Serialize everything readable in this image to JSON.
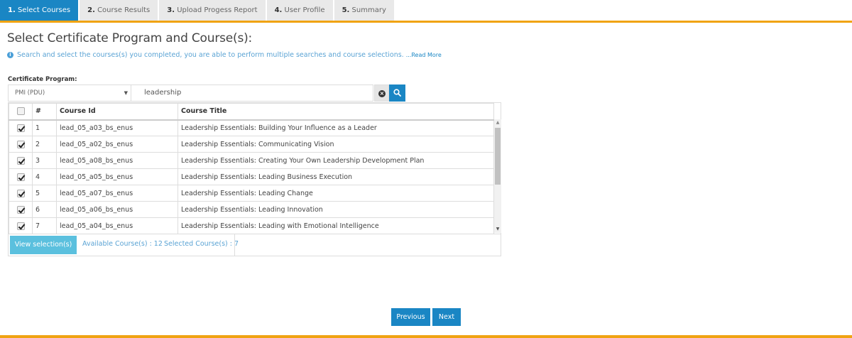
{
  "tabs": [
    {
      "num": "1.",
      "label": "Select Courses",
      "active": true
    },
    {
      "num": "2.",
      "label": "Course Results",
      "active": false
    },
    {
      "num": "3.",
      "label": "Upload Progess Report",
      "active": false
    },
    {
      "num": "4.",
      "label": "User Profile",
      "active": false
    },
    {
      "num": "5.",
      "label": "Summary",
      "active": false
    }
  ],
  "heading": "Select Certificate Program and Course(s):",
  "info": {
    "text": "Search and select the courses(s) you completed, you are able to perform multiple searches and course selections.",
    "read_more": "...Read More"
  },
  "program": {
    "label": "Certificate Program:",
    "selected": "PMI (PDU)"
  },
  "search": {
    "value": "leadership"
  },
  "table": {
    "headers": {
      "num": "#",
      "id": "Course Id",
      "title": "Course Title"
    },
    "rows": [
      {
        "num": "1",
        "id": "lead_05_a03_bs_enus",
        "title": "Leadership Essentials: Building Your Influence as a Leader",
        "checked": true
      },
      {
        "num": "2",
        "id": "lead_05_a02_bs_enus",
        "title": "Leadership Essentials: Communicating Vision",
        "checked": true
      },
      {
        "num": "3",
        "id": "lead_05_a08_bs_enus",
        "title": "Leadership Essentials: Creating Your Own Leadership Development Plan",
        "checked": true
      },
      {
        "num": "4",
        "id": "lead_05_a05_bs_enus",
        "title": "Leadership Essentials: Leading Business Execution",
        "checked": true
      },
      {
        "num": "5",
        "id": "lead_05_a07_bs_enus",
        "title": "Leadership Essentials: Leading Change",
        "checked": true
      },
      {
        "num": "6",
        "id": "lead_05_a06_bs_enus",
        "title": "Leadership Essentials: Leading Innovation",
        "checked": true
      },
      {
        "num": "7",
        "id": "lead_05_a04_bs_enus",
        "title": "Leadership Essentials: Leading with Emotional Intelligence",
        "checked": true
      }
    ]
  },
  "footer": {
    "view_button": "View selection(s)",
    "available": "Available Course(s) : 12",
    "selected": "Selected Course(s) : 7"
  },
  "nav": {
    "previous": "Previous",
    "next": "Next"
  },
  "colors": {
    "accent": "#1a86c4",
    "rule": "#f0a312",
    "info_text": "#5aa3d4",
    "view_button": "#5bc0de"
  }
}
